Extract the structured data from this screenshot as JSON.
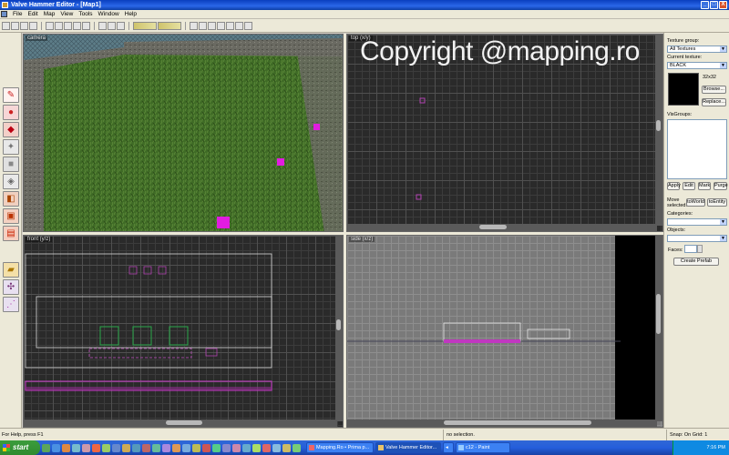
{
  "window": {
    "title": "Valve Hammer Editor - [Map1]",
    "controls": {
      "minimize": "_",
      "maximize": "□",
      "close": "X"
    }
  },
  "menu": {
    "items": [
      "File",
      "Edit",
      "Map",
      "View",
      "Tools",
      "Window",
      "Help"
    ]
  },
  "viewports": {
    "camera": {
      "label": "camera"
    },
    "top": {
      "label": "top (x/y)"
    },
    "front": {
      "label": "front (y/z)"
    },
    "side": {
      "label": "side (x/z)"
    }
  },
  "watermark": "Copyright @mapping.ro",
  "texture_panel": {
    "group_label": "Texture group:",
    "group_value": "All Textures",
    "current_label": "Current texture:",
    "current_value": "BLACK",
    "size": "32x32",
    "browse": "Browse...",
    "replace": "Replace...",
    "visgroups_label": "VisGroups:",
    "apply": "Apply",
    "edit": "Edit",
    "mark": "Mark",
    "purge": "Purge",
    "move_selected_line1": "Move",
    "move_selected_line2": "selected:",
    "to_world": "toWorld",
    "to_entity": "toEntity",
    "categories_label": "Categories:",
    "objects_label": "Objects:",
    "faces_label": "Faces:",
    "create_prefab": "Create Prefab"
  },
  "status": {
    "help": "For Help, press F1",
    "selection": "no selection.",
    "snap": "Snap: On Grid: 1"
  },
  "taskbar": {
    "start": "start",
    "tasks": [
      "Mapping.Ro • Prima p...",
      "Valve Hammer Editor...",
      "c12 - Paint"
    ],
    "clock": "7:16 PM"
  }
}
